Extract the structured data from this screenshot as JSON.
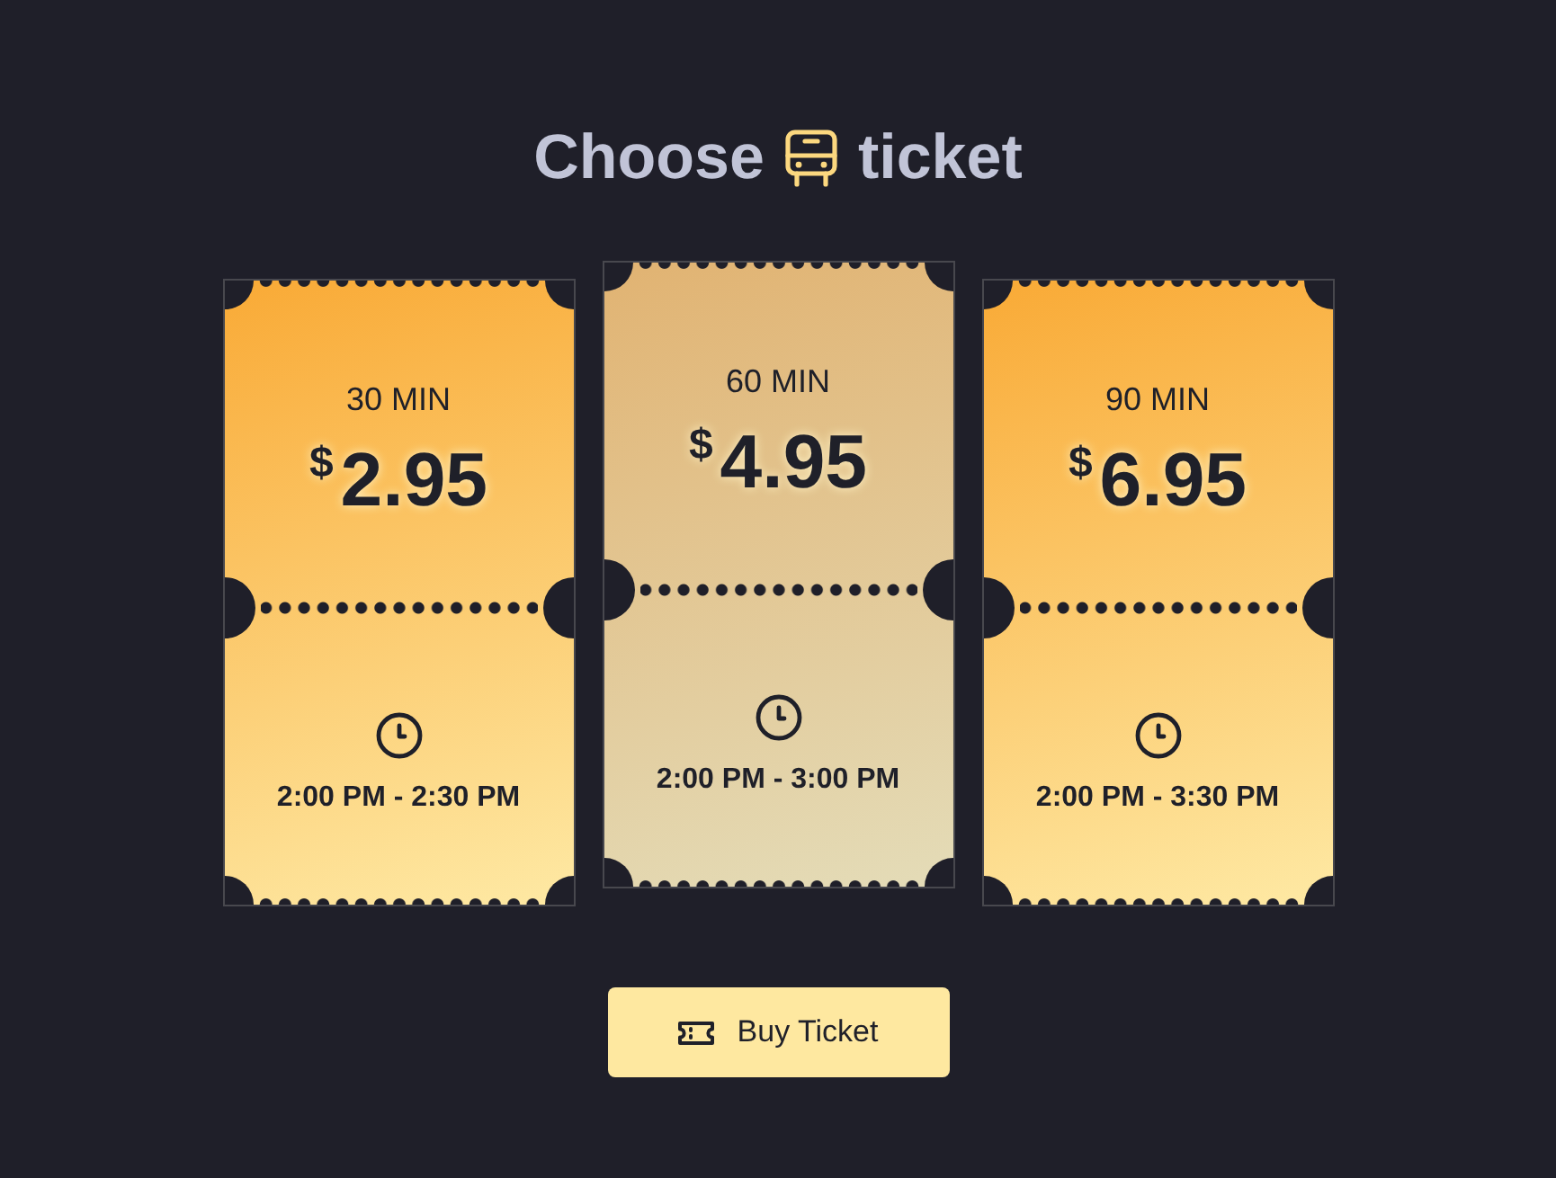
{
  "heading": {
    "text_before_icon": "Choose",
    "text_after_icon": "ticket"
  },
  "tickets": [
    {
      "duration": "30 MIN",
      "currency": "$",
      "price": "2.95",
      "time": "2:00 PM - 2:30 PM",
      "selected": false
    },
    {
      "duration": "60 MIN",
      "currency": "$",
      "price": "4.95",
      "time": "2:00 PM - 3:00 PM",
      "selected": true
    },
    {
      "duration": "90 MIN",
      "currency": "$",
      "price": "6.95",
      "time": "2:00 PM - 3:30 PM",
      "selected": false
    }
  ],
  "buy_button": {
    "label": "Buy Ticket"
  }
}
